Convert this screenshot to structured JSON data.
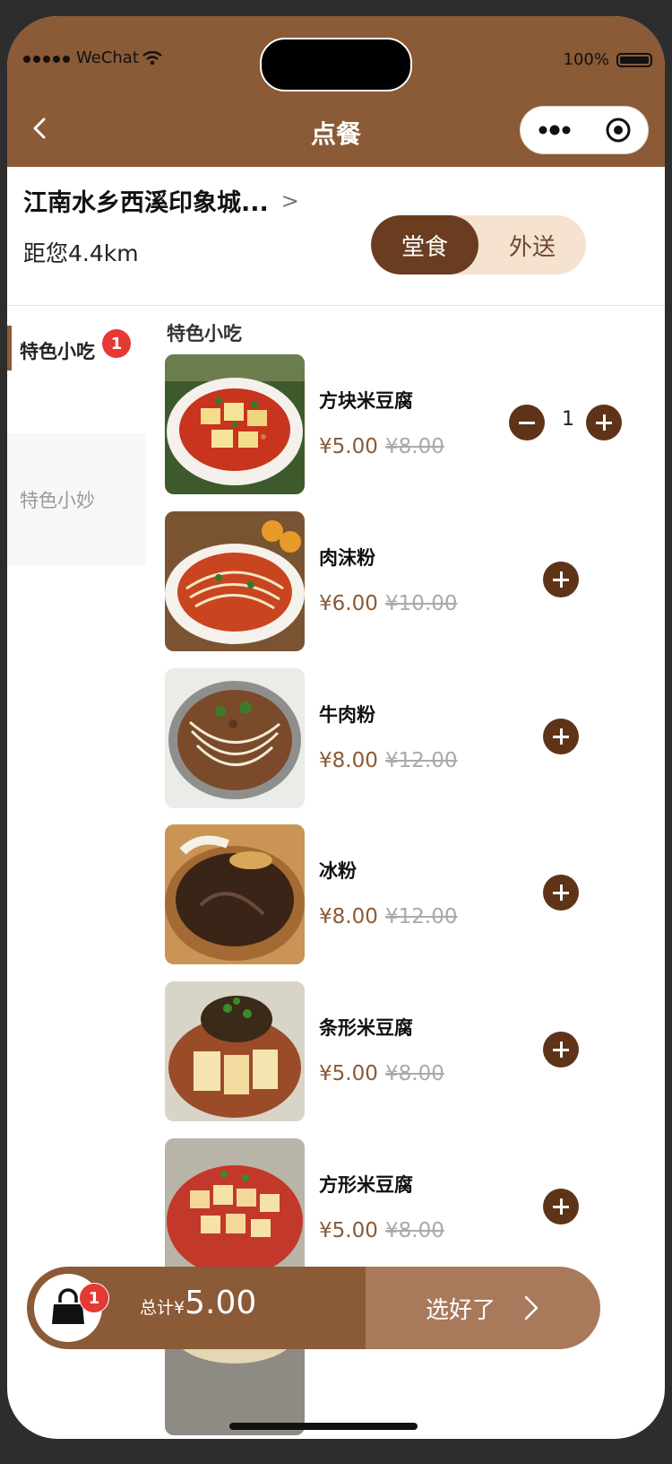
{
  "status": {
    "carrier": "WeChat",
    "battery": "100%"
  },
  "nav": {
    "title": "点餐"
  },
  "store": {
    "name": "江南水乡西溪印象城...",
    "arrow": ">",
    "distance": "距您4.4km"
  },
  "mode": {
    "dine_in": "堂食",
    "delivery": "外送"
  },
  "sidebar": {
    "items": [
      {
        "label": "特色小吃",
        "badge": "1"
      },
      {
        "label": "特色小妙"
      }
    ]
  },
  "section": {
    "title": "特色小吃"
  },
  "menu": [
    {
      "name": "方块米豆腐",
      "price": "¥5.00",
      "old_price": "¥8.00",
      "qty": "1"
    },
    {
      "name": "肉沫粉",
      "price": "¥6.00",
      "old_price": "¥10.00"
    },
    {
      "name": "牛肉粉",
      "price": "¥8.00",
      "old_price": "¥12.00"
    },
    {
      "name": "冰粉",
      "price": "¥8.00",
      "old_price": "¥12.00"
    },
    {
      "name": "条形米豆腐",
      "price": "¥5.00",
      "old_price": "¥8.00"
    },
    {
      "name": "方形米豆腐",
      "price": "¥5.00",
      "old_price": "¥8.00"
    }
  ],
  "cart": {
    "badge": "1",
    "total_label": "总计¥",
    "total": "5.00",
    "checkout": "选好了"
  },
  "colors": {
    "brand": "#8b5a36",
    "dark": "#5e3317",
    "badge": "#e53935"
  }
}
